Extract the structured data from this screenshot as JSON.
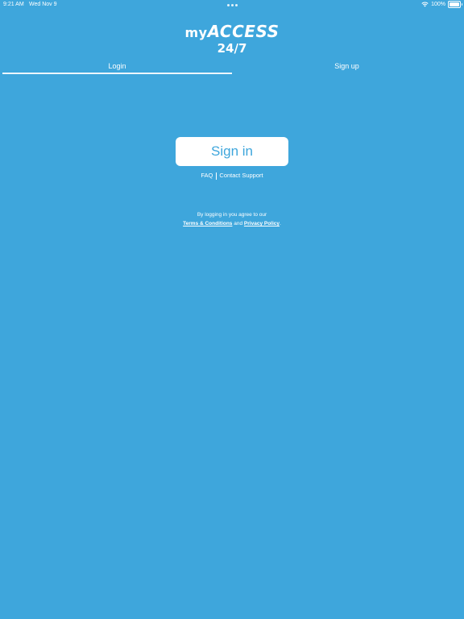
{
  "status_bar": {
    "time": "9:21 AM",
    "date": "Wed Nov 9",
    "battery": "100%"
  },
  "logo": {
    "my": "my",
    "access": "ACCESS",
    "hours": "24/7"
  },
  "tabs": [
    {
      "label": "Login",
      "selected": true
    },
    {
      "label": "Sign up",
      "selected": false
    }
  ],
  "signin_label": "Sign in",
  "help": {
    "faq": "FAQ",
    "contact": "Contact Support"
  },
  "legal": {
    "line1": "By logging in you agree to our",
    "terms": "Terms & Conditions",
    "and": "and",
    "privacy": "Privacy Policy",
    "period": "."
  },
  "colors": {
    "background": "#3ea6dc",
    "button_bg": "#ffffff",
    "button_text": "#3ea6dc"
  }
}
